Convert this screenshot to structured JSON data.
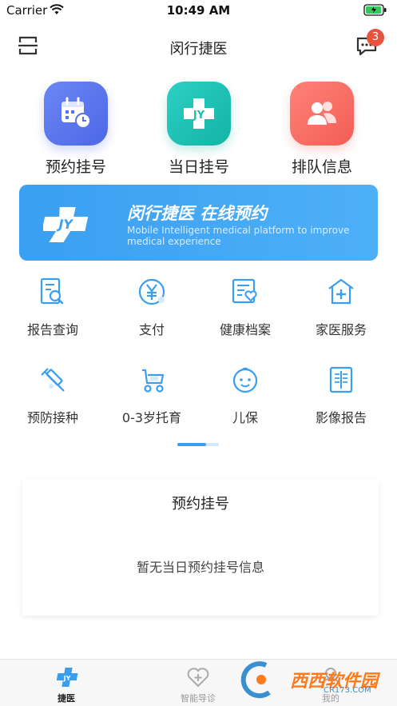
{
  "status_bar": {
    "carrier": "Carrier",
    "time": "10:49 AM"
  },
  "nav": {
    "title": "闵行捷医",
    "left_icon": "menu-icon",
    "right_icon": "message-icon",
    "badge_count": "3"
  },
  "top_services": [
    {
      "label": "预约挂号",
      "icon": "calendar-clock-icon",
      "color": "#5874ea"
    },
    {
      "label": "当日挂号",
      "icon": "jy-cross-icon",
      "color": "#1cbfb2"
    },
    {
      "label": "排队信息",
      "icon": "users-icon",
      "color": "#f76b62"
    }
  ],
  "banner": {
    "title": "闵行捷医 在线预约",
    "subtitle": "Mobile Intelligent medical platform to improve medical experience"
  },
  "grid": [
    {
      "label": "报告查询",
      "icon": "report-search-icon"
    },
    {
      "label": "支付",
      "icon": "yuan-coin-icon"
    },
    {
      "label": "健康档案",
      "icon": "health-record-icon"
    },
    {
      "label": "家医服务",
      "icon": "home-plus-icon"
    },
    {
      "label": "预防接种",
      "icon": "syringe-icon"
    },
    {
      "label": "0-3岁托育",
      "icon": "stroller-icon"
    },
    {
      "label": "儿保",
      "icon": "baby-face-icon"
    },
    {
      "label": "影像报告",
      "icon": "xray-icon"
    }
  ],
  "card": {
    "title": "预约挂号",
    "empty_text": "暂无当日预约挂号信息"
  },
  "tabs": [
    {
      "label": "捷医",
      "icon": "jy-cross-icon",
      "active": true
    },
    {
      "label": "智能导诊",
      "icon": "heart-plus-icon",
      "active": false
    },
    {
      "label": "我的",
      "icon": "person-icon",
      "active": false
    }
  ],
  "watermark": {
    "brand": "西西软件园",
    "url": "CR173.COM"
  },
  "colors": {
    "accent": "#3a9ef0",
    "badge": "#e8523f"
  }
}
